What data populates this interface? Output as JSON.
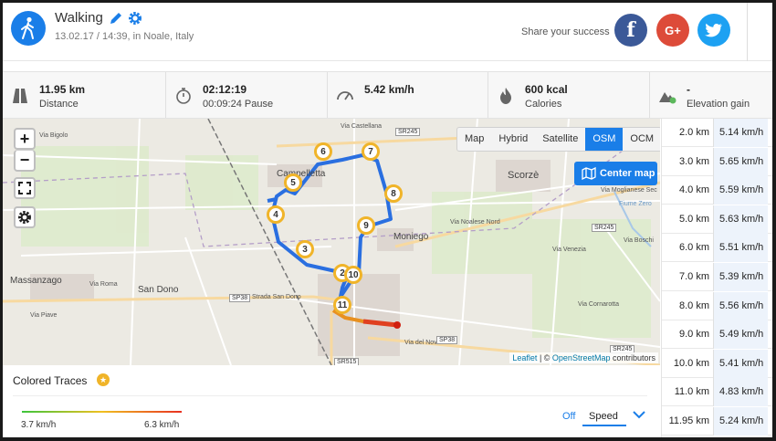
{
  "header": {
    "title": "Walking",
    "subtitle": "13.02.17 / 14:39, in Noale, Italy",
    "share_label": "Share your success",
    "social": {
      "facebook": "f",
      "googleplus": "G+",
      "twitter": "twitter-bird-icon"
    }
  },
  "stats": [
    {
      "icon": "road-icon",
      "value": "11.95 km",
      "label": "Distance"
    },
    {
      "icon": "stopwatch-icon",
      "value": "02:12:19",
      "label": "00:09:24 Pause"
    },
    {
      "icon": "speedometer-icon",
      "value": "5.42 km/h",
      "label": ""
    },
    {
      "icon": "flame-icon",
      "value": "600 kcal",
      "label": "Calories"
    },
    {
      "icon": "mountain-icon",
      "value": "-",
      "label": "Elevation gain"
    }
  ],
  "map": {
    "layers": [
      "Map",
      "Hybrid",
      "Satellite",
      "OSM",
      "OCM"
    ],
    "active_layer": "OSM",
    "center_label": "Center map",
    "attribution_leaflet": "Leaflet",
    "attribution_sep": " | © ",
    "attribution_osm": "OpenStreetMap",
    "attribution_tail": " contributors",
    "places": [
      "Massanzago",
      "San Dono",
      "Scorzè",
      "Campelletta",
      "Moniego"
    ],
    "road_labels": [
      "Via Bigolo",
      "Via Castellana",
      "Strada San Dono",
      "Via Roma",
      "Via del Novale",
      "Via Moglianese Sec",
      "Via Noalese Nord",
      "Via Venezia",
      "Via Boschi",
      "Via Cornarotta",
      "Via Piave",
      "Fiume Zero"
    ],
    "shields": [
      "SR245",
      "SR245",
      "SP38",
      "SP38",
      "SR515",
      "SR245"
    ],
    "markers": [
      "2",
      "3",
      "4",
      "5",
      "6",
      "7",
      "8",
      "9",
      "10",
      "11"
    ],
    "accent": "#1a7ee8",
    "route_color": "#2a6fe0"
  },
  "splits": [
    {
      "km": "2.0 km",
      "speed": "5.14 km/h"
    },
    {
      "km": "3.0 km",
      "speed": "5.65 km/h"
    },
    {
      "km": "4.0 km",
      "speed": "5.59 km/h"
    },
    {
      "km": "5.0 km",
      "speed": "5.63 km/h"
    },
    {
      "km": "6.0 km",
      "speed": "5.51 km/h"
    },
    {
      "km": "7.0 km",
      "speed": "5.39 km/h"
    },
    {
      "km": "8.0 km",
      "speed": "5.56 km/h"
    },
    {
      "km": "9.0 km",
      "speed": "5.49 km/h"
    },
    {
      "km": "10.0 km",
      "speed": "5.41 km/h"
    },
    {
      "km": "11.0 km",
      "speed": "4.83 km/h"
    },
    {
      "km": "11.95 km",
      "speed": "5.24 km/h"
    }
  ],
  "traces": {
    "title": "Colored Traces",
    "min_speed": "3.7 km/h",
    "max_speed": "6.3 km/h",
    "off_label": "Off",
    "metric": "Speed"
  }
}
